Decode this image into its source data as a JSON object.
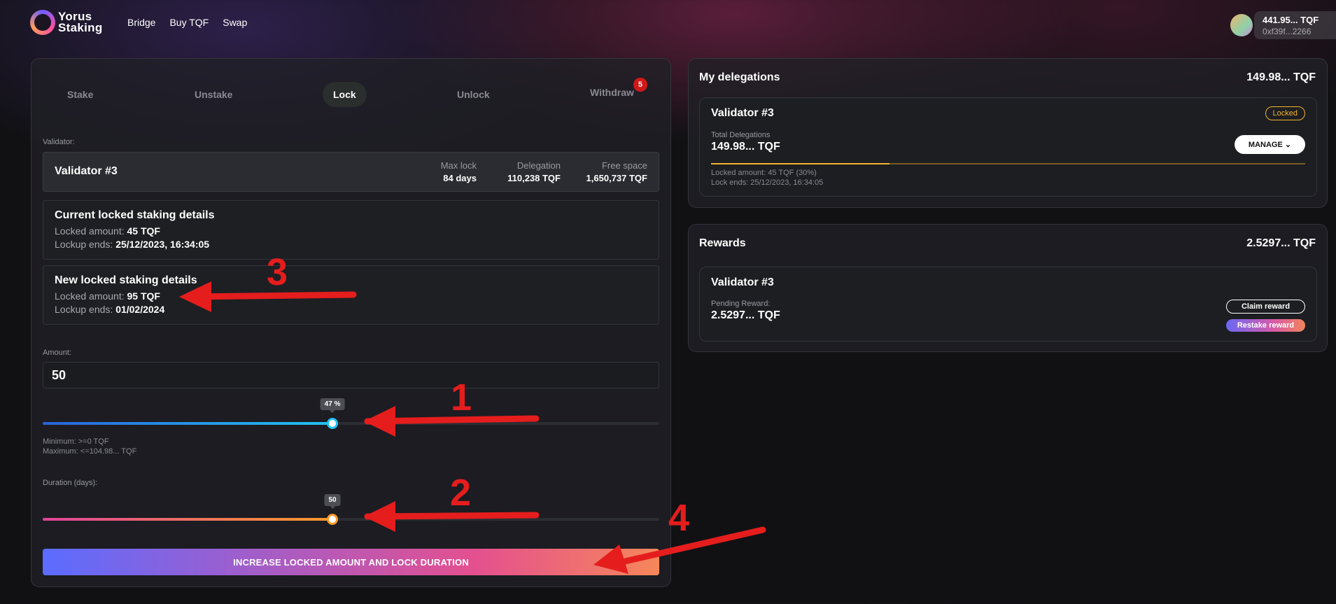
{
  "header": {
    "logo_line1": "Yorus",
    "logo_line2": "Staking",
    "nav": [
      "Bridge",
      "Buy TQF",
      "Swap"
    ],
    "wallet_balance": "441.95... TQF",
    "wallet_address": "0xf39f...2266"
  },
  "tabs": {
    "stake": "Stake",
    "unstake": "Unstake",
    "lock": "Lock",
    "unlock": "Unlock",
    "withdraw": "Withdraw",
    "withdraw_badge": "5",
    "active": "Lock"
  },
  "validator": {
    "label": "Validator:",
    "name": "Validator #3",
    "max_lock_label": "Max lock",
    "max_lock_value": "84 days",
    "delegation_label": "Delegation",
    "delegation_value": "110,238 TQF",
    "free_space_label": "Free space",
    "free_space_value": "1,650,737 TQF"
  },
  "current_details": {
    "title": "Current locked staking details",
    "amount_label": "Locked amount:",
    "amount_value": "45 TQF",
    "ends_label": "Lockup ends:",
    "ends_value": "25/12/2023, 16:34:05"
  },
  "new_details": {
    "title": "New locked staking details",
    "amount_label": "Locked amount:",
    "amount_value": "95 TQF",
    "ends_label": "Lockup ends:",
    "ends_value": "01/02/2024"
  },
  "amount": {
    "label": "Amount:",
    "value": "50",
    "slider_tooltip": "47 %",
    "slider_fraction": 0.47,
    "min_text": "Minimum: >=0 TQF",
    "max_text": "Maximum: <=104.98... TQF",
    "fill_gradient_start": "#2b63d9",
    "fill_gradient_end": "#21c4f0"
  },
  "duration": {
    "label": "Duration (days):",
    "slider_tooltip": "50",
    "slider_fraction": 0.47,
    "fill_gradient_start": "#e0459a",
    "fill_gradient_end": "#f79a2a"
  },
  "submit_label": "INCREASE LOCKED AMOUNT AND LOCK DURATION",
  "delegations": {
    "title": "My delegations",
    "total": "149.98... TQF",
    "card": {
      "name": "Validator #3",
      "status": "Locked",
      "total_label": "Total Delegations",
      "total_value": "149.98... TQF",
      "manage_label": "MANAGE",
      "locked_fraction": 0.3,
      "locked_amount_text": "Locked amount: 45 TQF (30%)",
      "lock_ends_text": "Lock ends: 25/12/2023, 16:34:05"
    }
  },
  "rewards": {
    "title": "Rewards",
    "total": "2.5297... TQF",
    "card": {
      "name": "Validator #3",
      "pending_label": "Pending Reward:",
      "pending_value": "2.5297... TQF",
      "claim_label": "Claim reward",
      "restake_label": "Restake reward"
    }
  },
  "annotations": [
    "1",
    "2",
    "3",
    "4"
  ],
  "colors": {
    "annotation_red": "#e51d1d",
    "locked_yellow": "#f2b330",
    "badge_red": "#d01818"
  }
}
